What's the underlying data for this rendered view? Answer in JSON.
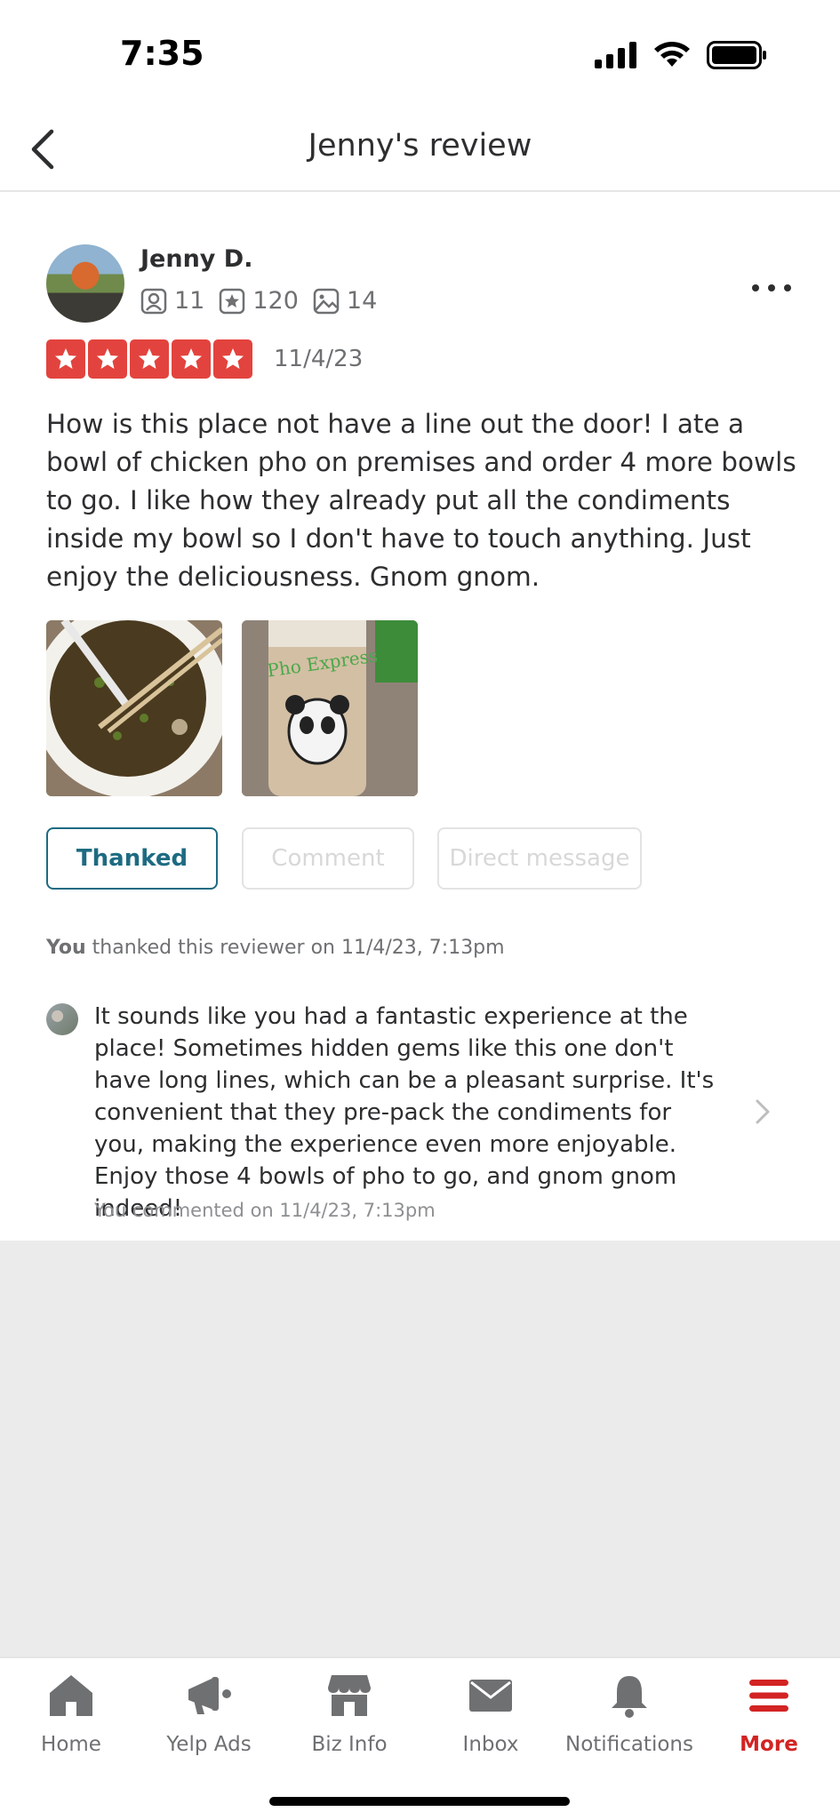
{
  "status_bar": {
    "time": "7:35"
  },
  "nav": {
    "title": "Jenny's review"
  },
  "reviewer": {
    "name": "Jenny D.",
    "friends": "11",
    "reviews": "120",
    "photos": "14"
  },
  "review": {
    "rating": 5,
    "date": "11/4/23",
    "text": "How is this place not have a line out the door!  I ate a bowl of chicken pho on premises and order 4 more bowls to go.  I like how they already put all the condiments inside my bowl so I don't have to touch anything.  Just enjoy the deliciousness.  Gnom gnom.",
    "photo2_caption": "Pho Express"
  },
  "actions": {
    "thanked": "Thanked",
    "comment": "Comment",
    "direct_message": "Direct message"
  },
  "thanked_note": {
    "you": "You",
    "rest": " thanked this reviewer on 11/4/23, 7:13pm"
  },
  "comment": {
    "text": "It sounds like you had a fantastic experience at the place! Sometimes hidden gems like this one don't have long lines, which can be a pleasant surprise. It's convenient that they pre-pack the condiments for you, making the experience even more enjoyable. Enjoy those 4 bowls of pho to go, and gnom gnom indeed!",
    "meta": "You commented on 11/4/23, 7:13pm"
  },
  "tabs": [
    {
      "label": "Home",
      "icon": "home-icon"
    },
    {
      "label": "Yelp Ads",
      "icon": "megaphone-icon"
    },
    {
      "label": "Biz Info",
      "icon": "storefront-icon"
    },
    {
      "label": "Inbox",
      "icon": "envelope-icon"
    },
    {
      "label": "Notifications",
      "icon": "bell-icon"
    },
    {
      "label": "More",
      "icon": "menu-icon",
      "active": true
    }
  ],
  "colors": {
    "star_red": "#e3433e",
    "accent_teal": "#1e6b82",
    "active_tab_red": "#d32323"
  }
}
